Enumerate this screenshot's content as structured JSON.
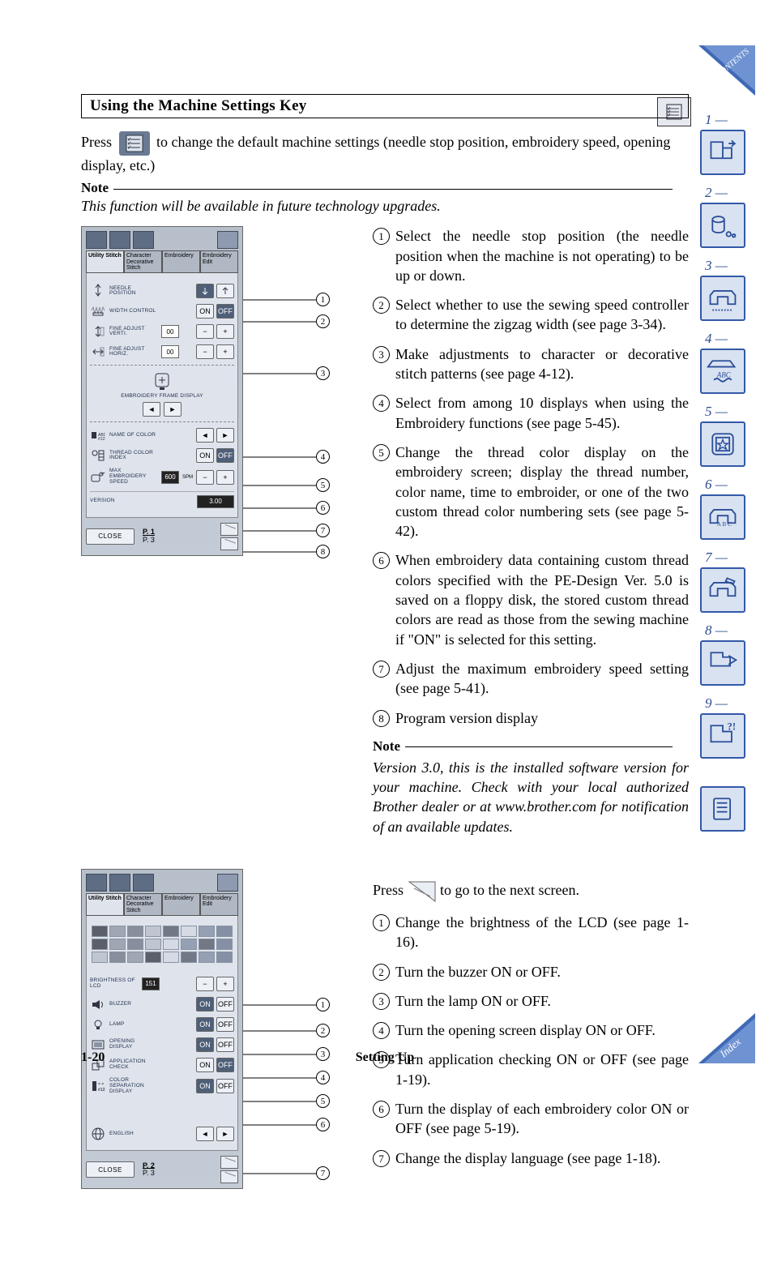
{
  "heading": "Using the Machine Settings Key",
  "intro_prefix": "Press",
  "intro_suffix": "to change the default machine settings (needle stop position, embroidery speed, opening display, etc.)",
  "note_label": "Note",
  "note_text": "This function will be available in future technology upgrades.",
  "screen1": {
    "tabs": [
      "Utility Stitch",
      "Character Decorative Stitch",
      "Embroidery",
      "Embroidery Edit"
    ],
    "rows": {
      "needle_position": "NEEDLE POSITION",
      "width_control": "WIDTH CONTROL",
      "fine_vert": "FINE ADJUST VERTI.",
      "fine_vert_val": "00",
      "fine_horiz": "FINE ADJUST HORIZ.",
      "fine_horiz_val": "00",
      "emb_frame": "EMBROIDERY FRAME DISPLAY",
      "name_color": "NAME OF COLOR",
      "thread_index": "THREAD COLOR INDEX",
      "max_speed": "MAX EMBROIDERY SPEED",
      "max_speed_val": "600",
      "max_speed_unit": "SPM",
      "version_label": "VERSION",
      "version_value": "3.00"
    },
    "on": "ON",
    "off": "OFF",
    "minus": "−",
    "plus": "+",
    "left": "◄",
    "right": "►",
    "close": "CLOSE",
    "page_cur": "P. 1",
    "page_total": "P. 3"
  },
  "list1": [
    "Select the needle stop position (the needle position when the machine is not operating) to be up or down.",
    "Select whether to use the sewing speed controller to determine the zigzag width (see page 3-34).",
    "Make adjustments to character or decorative stitch patterns (see page 4-12).",
    "Select from among 10 displays when using the Embroidery functions (see page 5-45).",
    "Change the thread color display on the embroidery screen; display the thread number, color name, time to embroider, or one of the two custom thread color numbering sets (see page 5-42).",
    "When embroidery data containing custom thread colors specified with the PE-Design Ver. 5.0 is saved on a floppy disk, the stored custom thread colors are read as those from the sewing machine if \"ON\" is selected for this setting.",
    "Adjust the maximum embroidery speed setting (see page 5-41).",
    "Program version display"
  ],
  "sub_note_label": "Note",
  "sub_note_text": "Version 3.0, this is the installed software version for your machine. Check with your local authorized Brother dealer or at www.brother.com for notification of an available updates.",
  "press_prefix": "Press",
  "press_suffix": "to go to the next screen.",
  "screen2": {
    "rows": {
      "brightness": "BRIGHTNESS OF LCD",
      "brightness_val": "151",
      "buzzer": "BUZZER",
      "lamp": "LAMP",
      "opening": "OPENING DISPLAY",
      "appcheck": "APPLICATION CHECK",
      "colorsep": "COLOR SEPARATION DISPLAY",
      "english": "ENGLISH"
    },
    "page_cur": "P. 2",
    "page_total": "P. 3",
    "close": "CLOSE"
  },
  "list2": [
    "Change the brightness of the LCD (see page 1-16).",
    "Turn the buzzer ON or OFF.",
    "Turn the lamp ON or OFF.",
    "Turn the opening screen display ON or OFF.",
    "Turn application checking ON or OFF (see page 1-19).",
    "Turn the display of each embroidery color ON or OFF (see page 5-19).",
    "Change the display language (see page 1-18)."
  ],
  "footer": {
    "page": "1-20",
    "title": "Setting Up"
  },
  "nav": {
    "contents": "CONTENTS",
    "index": "Index",
    "chapters": [
      "1 —",
      "2 —",
      "3 —",
      "4 —",
      "5 —",
      "6 —",
      "7 —",
      "8 —",
      "9 —"
    ]
  },
  "swatch_colors": [
    "#5a5f6b",
    "#a0a6b4",
    "#888e9b",
    "#bfc6d2",
    "#727885",
    "#d5dae4",
    "#95a0b4",
    "#858fa5",
    "#5a5f6b",
    "#a0a6b4",
    "#888e9b",
    "#bfc6d2",
    "#d5dae4",
    "#95a0b4",
    "#727885",
    "#858fa5",
    "#bfc6d2",
    "#888e9b",
    "#a0a6b4",
    "#5a5f6b",
    "#d5dae4",
    "#727885",
    "#95a0b4",
    "#858fa5"
  ]
}
